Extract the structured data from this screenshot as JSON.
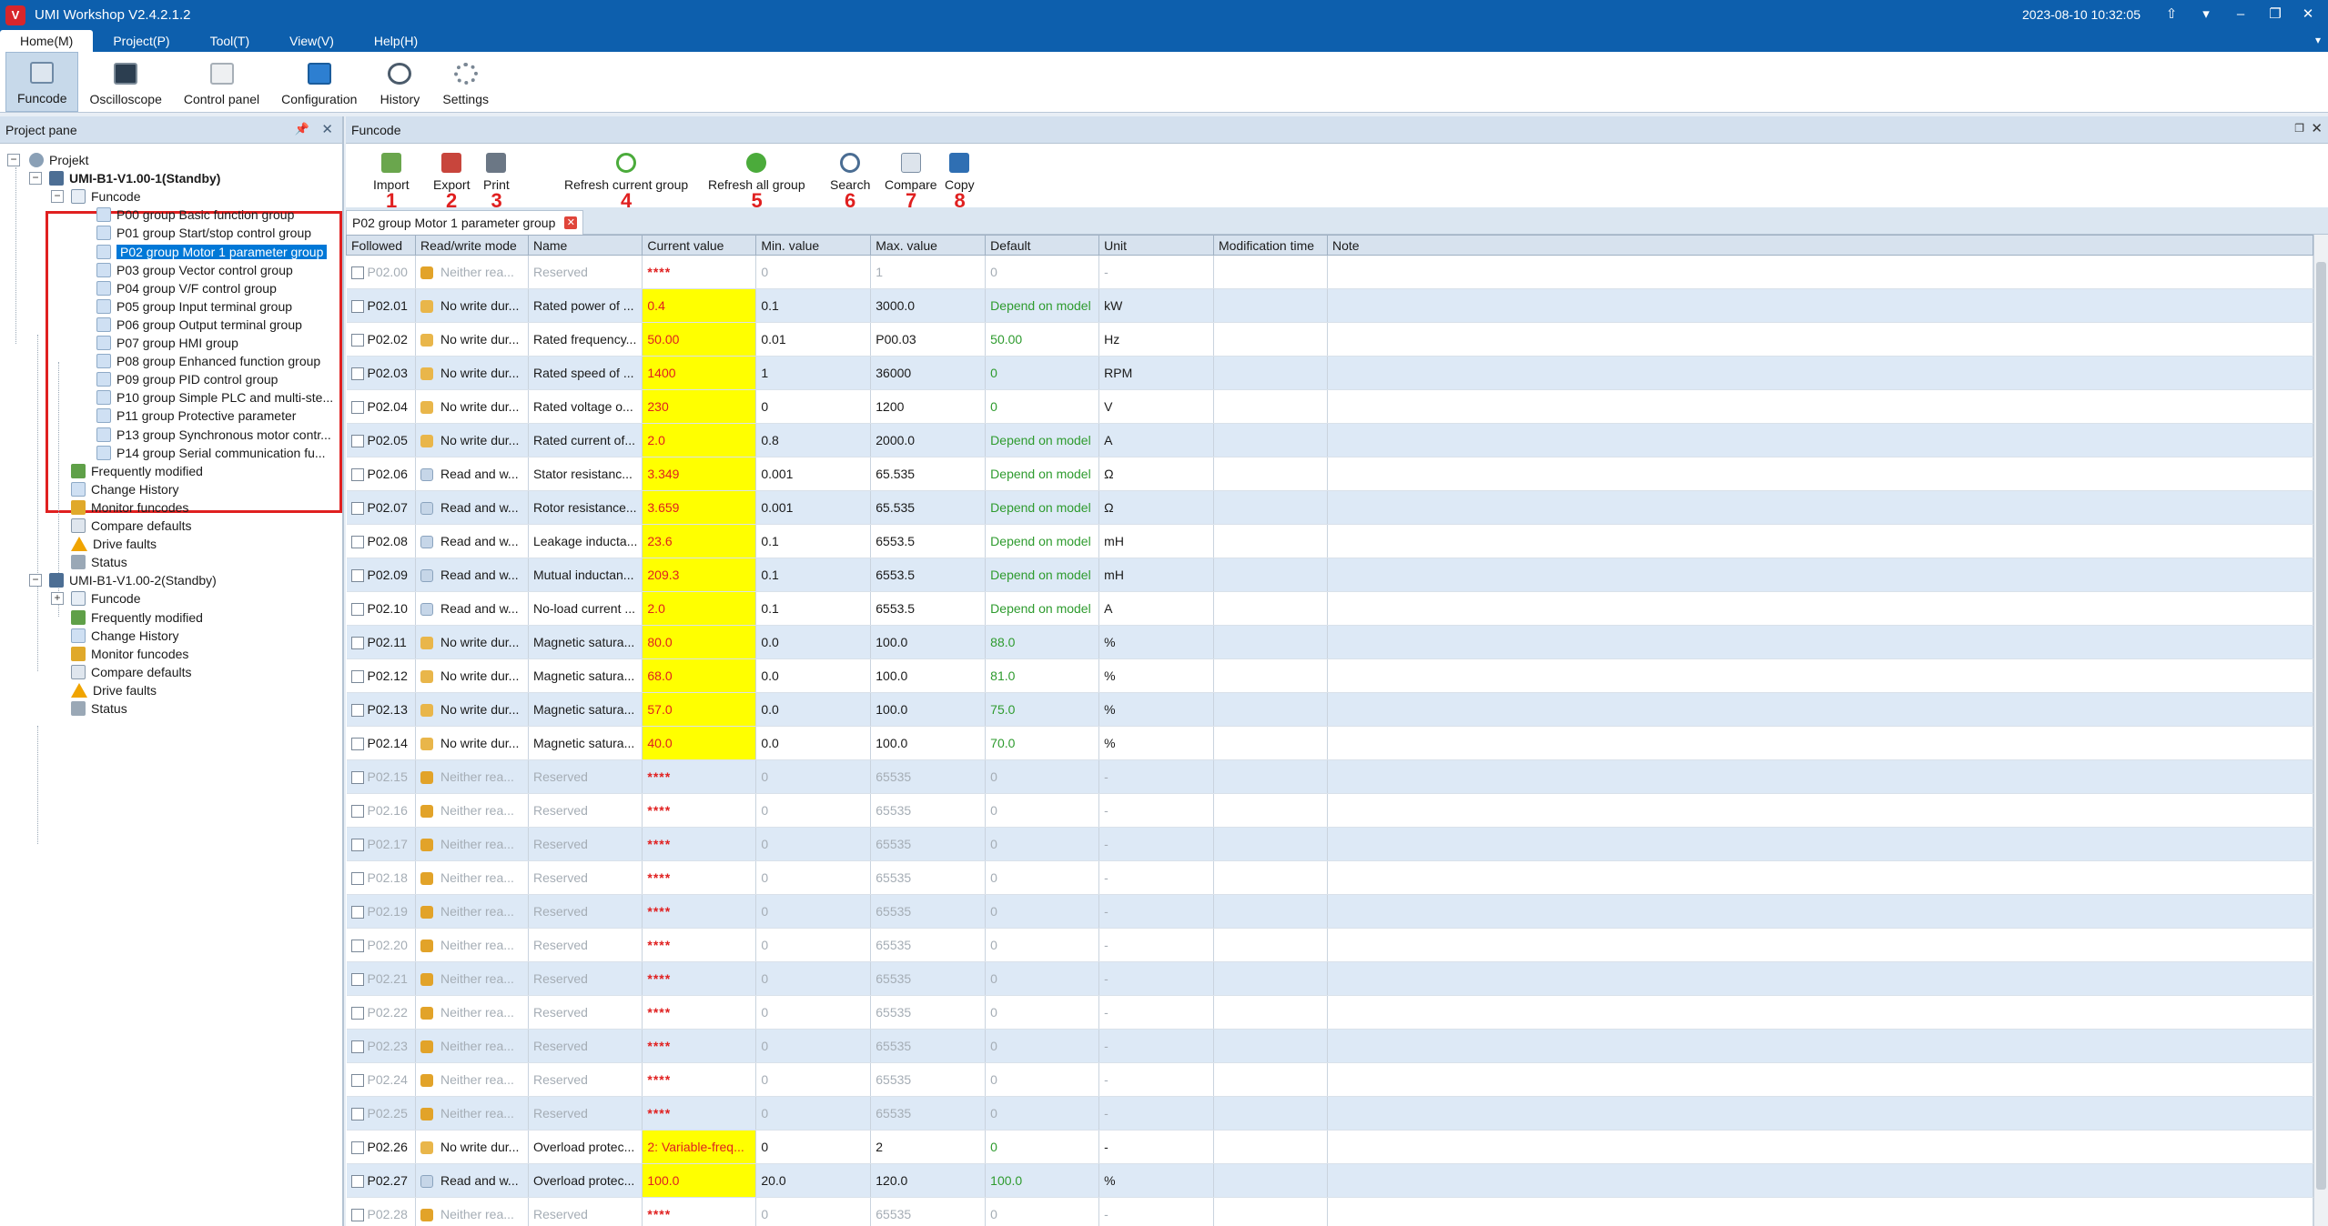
{
  "app": {
    "logo": "V",
    "title": "UMI Workshop V2.4.2.1.2",
    "datetime": "2023-08-10 10:32:05"
  },
  "menu": [
    "Home(M)",
    "Project(P)",
    "Tool(T)",
    "View(V)",
    "Help(H)"
  ],
  "ribbon": [
    {
      "label": "Funcode",
      "icon": "funcode-icon"
    },
    {
      "label": "Oscilloscope",
      "icon": "oscilloscope-icon"
    },
    {
      "label": "Control panel",
      "icon": "control-panel-icon"
    },
    {
      "label": "Configuration",
      "icon": "configuration-icon"
    },
    {
      "label": "History",
      "icon": "history-icon"
    },
    {
      "label": "Settings",
      "icon": "settings-icon"
    }
  ],
  "project_pane": {
    "title": "Project pane",
    "root": "Projekt",
    "device1": "UMI-B1-V1.00-1(Standby)",
    "device2": "UMI-B1-V1.00-2(Standby)",
    "funcode": "Funcode",
    "groups": [
      "P00 group Basic function group",
      "P01 group Start/stop control group",
      "P02 group Motor 1 parameter group",
      "P03 group Vector control group",
      "P04 group V/F control group",
      "P05 group Input terminal group",
      "P06 group Output terminal group",
      "P07 group HMI group",
      "P08 group Enhanced function group",
      "P09 group PID control group",
      "P10 group Simple PLC and multi-ste...",
      "P11 group Protective parameter",
      "P13 group Synchronous motor contr...",
      "P14 group Serial communication fu..."
    ],
    "device_items": [
      "Frequently modified",
      "Change History",
      "Monitor funcodes",
      "Compare defaults",
      "Drive faults",
      "Status"
    ]
  },
  "main": {
    "title": "Funcode",
    "doc_tab": "P02 group Motor 1 parameter group",
    "toolbar": [
      {
        "label": "Import",
        "num": "1"
      },
      {
        "label": "Export",
        "num": "2"
      },
      {
        "label": "Print",
        "num": "3"
      },
      {
        "label": "Refresh current group",
        "num": "4"
      },
      {
        "label": "Refresh all group",
        "num": "5"
      },
      {
        "label": "Search",
        "num": "6"
      },
      {
        "label": "Compare",
        "num": "7"
      },
      {
        "label": "Copy",
        "num": "8"
      }
    ],
    "columns": [
      "Followed",
      "Read/write mode",
      "Name",
      "Current value",
      "Min. value",
      "Max. value",
      "Default",
      "Unit",
      "Modification time",
      "Note"
    ],
    "rows": [
      {
        "code": "P02.00",
        "mode": "Neither rea...",
        "lock": "locked",
        "name": "Reserved",
        "cur": "****",
        "min": "0",
        "max": "1",
        "def": "0",
        "unit": "-",
        "reserved": true
      },
      {
        "code": "P02.01",
        "mode": "No write dur...",
        "lock": "pen",
        "name": "Rated power of ...",
        "cur": "0.4",
        "min": "0.1",
        "max": "3000.0",
        "def": "Depend on model",
        "unit": "kW"
      },
      {
        "code": "P02.02",
        "mode": "No write dur...",
        "lock": "pen",
        "name": "Rated frequency...",
        "cur": "50.00",
        "min": "0.01",
        "max": "P00.03",
        "def": "50.00",
        "unit": "Hz"
      },
      {
        "code": "P02.03",
        "mode": "No write dur...",
        "lock": "pen",
        "name": "Rated speed of ...",
        "cur": "1400",
        "min": "1",
        "max": "36000",
        "def": "0",
        "unit": "RPM"
      },
      {
        "code": "P02.04",
        "mode": "No write dur...",
        "lock": "pen",
        "name": "Rated voltage o...",
        "cur": "230",
        "min": "0",
        "max": "1200",
        "def": "0",
        "unit": "V"
      },
      {
        "code": "P02.05",
        "mode": "No write dur...",
        "lock": "pen",
        "name": "Rated current of...",
        "cur": "2.0",
        "min": "0.8",
        "max": "2000.0",
        "def": "Depend on model",
        "unit": "A"
      },
      {
        "code": "P02.06",
        "mode": "Read and w...",
        "lock": "rw",
        "name": "Stator resistanc...",
        "cur": "3.349",
        "min": "0.001",
        "max": "65.535",
        "def": "Depend on model",
        "unit": "Ω"
      },
      {
        "code": "P02.07",
        "mode": "Read and w...",
        "lock": "rw",
        "name": "Rotor resistance...",
        "cur": "3.659",
        "min": "0.001",
        "max": "65.535",
        "def": "Depend on model",
        "unit": "Ω"
      },
      {
        "code": "P02.08",
        "mode": "Read and w...",
        "lock": "rw",
        "name": "Leakage inducta...",
        "cur": "23.6",
        "min": "0.1",
        "max": "6553.5",
        "def": "Depend on model",
        "unit": "mH"
      },
      {
        "code": "P02.09",
        "mode": "Read and w...",
        "lock": "rw",
        "name": "Mutual inductan...",
        "cur": "209.3",
        "min": "0.1",
        "max": "6553.5",
        "def": "Depend on model",
        "unit": "mH"
      },
      {
        "code": "P02.10",
        "mode": "Read and w...",
        "lock": "rw",
        "name": "No-load current ...",
        "cur": "2.0",
        "min": "0.1",
        "max": "6553.5",
        "def": "Depend on model",
        "unit": "A"
      },
      {
        "code": "P02.11",
        "mode": "No write dur...",
        "lock": "pen",
        "name": "Magnetic satura...",
        "cur": "80.0",
        "min": "0.0",
        "max": "100.0",
        "def": "88.0",
        "unit": "%"
      },
      {
        "code": "P02.12",
        "mode": "No write dur...",
        "lock": "pen",
        "name": "Magnetic satura...",
        "cur": "68.0",
        "min": "0.0",
        "max": "100.0",
        "def": "81.0",
        "unit": "%"
      },
      {
        "code": "P02.13",
        "mode": "No write dur...",
        "lock": "pen",
        "name": "Magnetic satura...",
        "cur": "57.0",
        "min": "0.0",
        "max": "100.0",
        "def": "75.0",
        "unit": "%"
      },
      {
        "code": "P02.14",
        "mode": "No write dur...",
        "lock": "pen",
        "name": "Magnetic satura...",
        "cur": "40.0",
        "min": "0.0",
        "max": "100.0",
        "def": "70.0",
        "unit": "%"
      },
      {
        "code": "P02.15",
        "mode": "Neither rea...",
        "lock": "locked",
        "name": "Reserved",
        "cur": "****",
        "min": "0",
        "max": "65535",
        "def": "0",
        "unit": "-",
        "reserved": true
      },
      {
        "code": "P02.16",
        "mode": "Neither rea...",
        "lock": "locked",
        "name": "Reserved",
        "cur": "****",
        "min": "0",
        "max": "65535",
        "def": "0",
        "unit": "-",
        "reserved": true
      },
      {
        "code": "P02.17",
        "mode": "Neither rea...",
        "lock": "locked",
        "name": "Reserved",
        "cur": "****",
        "min": "0",
        "max": "65535",
        "def": "0",
        "unit": "-",
        "reserved": true
      },
      {
        "code": "P02.18",
        "mode": "Neither rea...",
        "lock": "locked",
        "name": "Reserved",
        "cur": "****",
        "min": "0",
        "max": "65535",
        "def": "0",
        "unit": "-",
        "reserved": true
      },
      {
        "code": "P02.19",
        "mode": "Neither rea...",
        "lock": "locked",
        "name": "Reserved",
        "cur": "****",
        "min": "0",
        "max": "65535",
        "def": "0",
        "unit": "-",
        "reserved": true
      },
      {
        "code": "P02.20",
        "mode": "Neither rea...",
        "lock": "locked",
        "name": "Reserved",
        "cur": "****",
        "min": "0",
        "max": "65535",
        "def": "0",
        "unit": "-",
        "reserved": true
      },
      {
        "code": "P02.21",
        "mode": "Neither rea...",
        "lock": "locked",
        "name": "Reserved",
        "cur": "****",
        "min": "0",
        "max": "65535",
        "def": "0",
        "unit": "-",
        "reserved": true
      },
      {
        "code": "P02.22",
        "mode": "Neither rea...",
        "lock": "locked",
        "name": "Reserved",
        "cur": "****",
        "min": "0",
        "max": "65535",
        "def": "0",
        "unit": "-",
        "reserved": true
      },
      {
        "code": "P02.23",
        "mode": "Neither rea...",
        "lock": "locked",
        "name": "Reserved",
        "cur": "****",
        "min": "0",
        "max": "65535",
        "def": "0",
        "unit": "-",
        "reserved": true
      },
      {
        "code": "P02.24",
        "mode": "Neither rea...",
        "lock": "locked",
        "name": "Reserved",
        "cur": "****",
        "min": "0",
        "max": "65535",
        "def": "0",
        "unit": "-",
        "reserved": true
      },
      {
        "code": "P02.25",
        "mode": "Neither rea...",
        "lock": "locked",
        "name": "Reserved",
        "cur": "****",
        "min": "0",
        "max": "65535",
        "def": "0",
        "unit": "-",
        "reserved": true
      },
      {
        "code": "P02.26",
        "mode": "No write dur...",
        "lock": "pen",
        "name": "Overload protec...",
        "cur": "2: Variable-freq...",
        "min": "0",
        "max": "2",
        "def": "0",
        "unit": "-"
      },
      {
        "code": "P02.27",
        "mode": "Read and w...",
        "lock": "rw",
        "name": "Overload protec...",
        "cur": "100.0",
        "min": "20.0",
        "max": "120.0",
        "def": "100.0",
        "unit": "%"
      },
      {
        "code": "P02.28",
        "mode": "Neither rea...",
        "lock": "locked",
        "name": "Reserved",
        "cur": "****",
        "min": "0",
        "max": "65535",
        "def": "0",
        "unit": "-",
        "reserved": true
      }
    ]
  },
  "colors": {
    "titlebar": "#0d5fad",
    "highlight": "#ffff00",
    "value_text": "#e02020",
    "default_text": "#2e9b2e",
    "selection": "#0078d7",
    "annotation_red": "#e02020"
  }
}
